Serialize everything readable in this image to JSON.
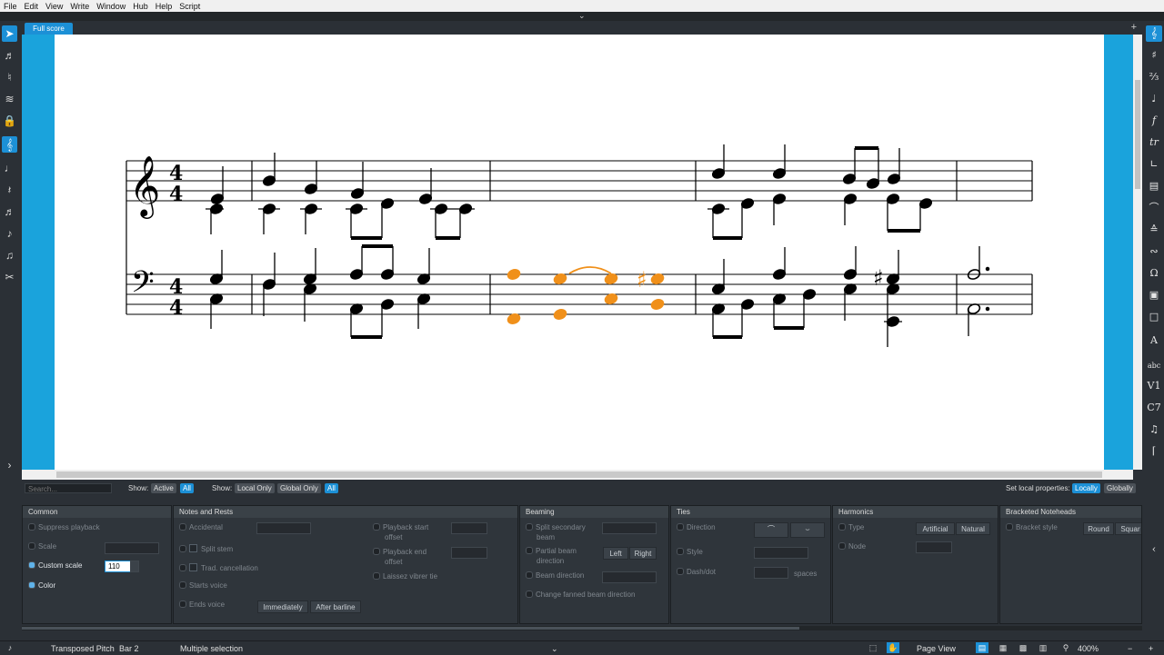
{
  "menu": [
    "File",
    "Edit",
    "View",
    "Write",
    "Window",
    "Hub",
    "Help",
    "Script"
  ],
  "tab_label": "Full score",
  "filter": {
    "search_placeholder": "Search...",
    "show1_label": "Show:",
    "show1_opts": [
      "Active",
      "All"
    ],
    "show2_label": "Show:",
    "show2_opts": [
      "Local Only",
      "Global Only",
      "All"
    ],
    "set_local_label": "Set local properties:",
    "set_local_opts": [
      "Locally",
      "Globally"
    ]
  },
  "panels": {
    "common": {
      "title": "Common",
      "suppress": "Suppress playback",
      "scale": "Scale",
      "custom_scale": "Custom scale",
      "custom_scale_value": "110",
      "color": "Color"
    },
    "notes": {
      "title": "Notes and Rests",
      "accidental": "Accidental",
      "split_stem": "Split stem",
      "trad_cancel": "Trad. cancellation",
      "starts_voice": "Starts voice",
      "ends_voice": "Ends voice",
      "immediately": "Immediately",
      "after_barline": "After barline",
      "playback_start": "Playback start",
      "playback_start2": "offset",
      "playback_end": "Playback end",
      "playback_end2": "offset",
      "laissez": "Laissez vibrer tie"
    },
    "beaming": {
      "title": "Beaming",
      "split_secondary": "Split secondary",
      "split_secondary2": "beam",
      "partial_beam": "Partial beam",
      "partial_beam2": "direction",
      "left": "Left",
      "right": "Right",
      "beam_direction": "Beam direction",
      "fanned": "Change fanned beam direction"
    },
    "ties": {
      "title": "Ties",
      "direction": "Direction",
      "style": "Style",
      "dash": "Dash/dot",
      "spaces": "spaces"
    },
    "harmonics": {
      "title": "Harmonics",
      "type": "Type",
      "artificial": "Artificial",
      "natural": "Natural",
      "node": "Node"
    },
    "bracketed": {
      "title": "Bracketed Noteheads",
      "style": "Bracket style",
      "round": "Round",
      "square": "Squar"
    }
  },
  "status": {
    "mode": "Transposed Pitch",
    "bar": "Bar 2",
    "selection": "Multiple selection",
    "view": "Page View",
    "zoom": "400%"
  },
  "colors": {
    "accent": "#1c90d6",
    "selection": "#f0901a"
  }
}
